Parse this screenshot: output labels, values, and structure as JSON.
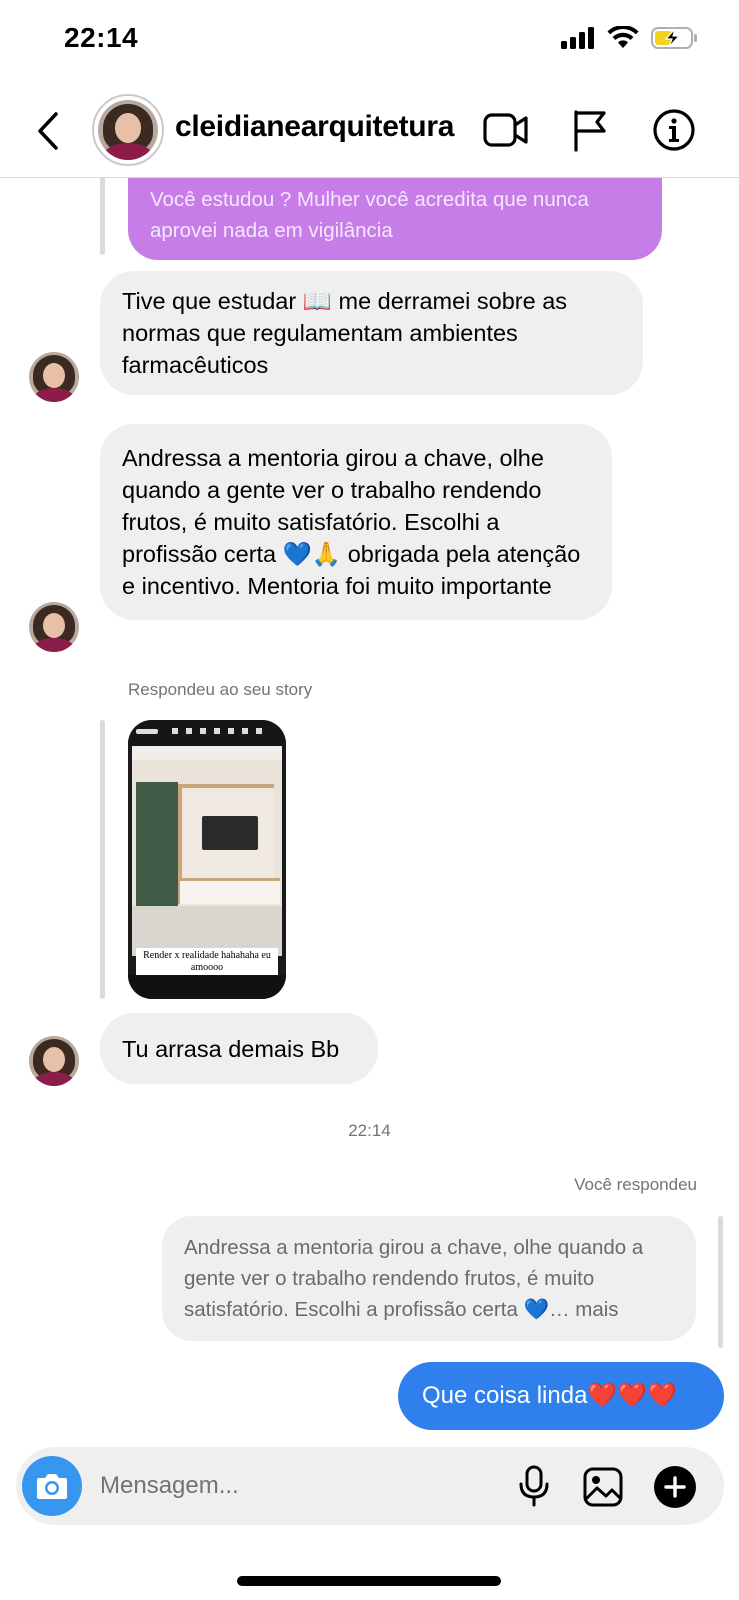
{
  "status_bar": {
    "time": "22:14"
  },
  "header": {
    "username": "cleidianearquitetura"
  },
  "messages": {
    "quoted_purple": "Você estudou ? Mulher você acredita que nunca aprovei nada em vigilância",
    "msg1": "Tive que estudar 📖 me derramei sobre as normas que regulamentam ambientes farmacêuticos",
    "msg2": "Andressa a mentoria girou a chave, olhe quando a gente ver o trabalho rendendo frutos, é muito satisfatório. Escolhi a profissão certa 💙🙏 obrigada pela atenção e incentivo. Mentoria foi muito importante",
    "story_reply_label": "Respondeu ao seu story",
    "story_caption": "Render x realidade hahahaha eu amoooo",
    "msg3": "Tu arrasa demais Bb",
    "timestamp": "22:14",
    "you_replied_label": "Você respondeu",
    "quoted_reply": "Andressa a mentoria girou a chave, olhe quando a gente ver o trabalho rendendo frutos, é muito satisfatório. Escolhi a profissão certa 💙… mais",
    "outgoing": "Que coisa linda❤️❤️❤️"
  },
  "composer": {
    "placeholder": "Mensagem..."
  },
  "colors": {
    "outgoing_bubble": "#2f80ed",
    "incoming_bubble": "#efefef",
    "quoted_story_bubble": "#c77de8",
    "camera_button": "#3797f0"
  },
  "icons": [
    "back-icon",
    "video-call-icon",
    "flag-icon",
    "info-icon",
    "camera-icon",
    "microphone-icon",
    "gallery-icon",
    "plus-icon"
  ]
}
